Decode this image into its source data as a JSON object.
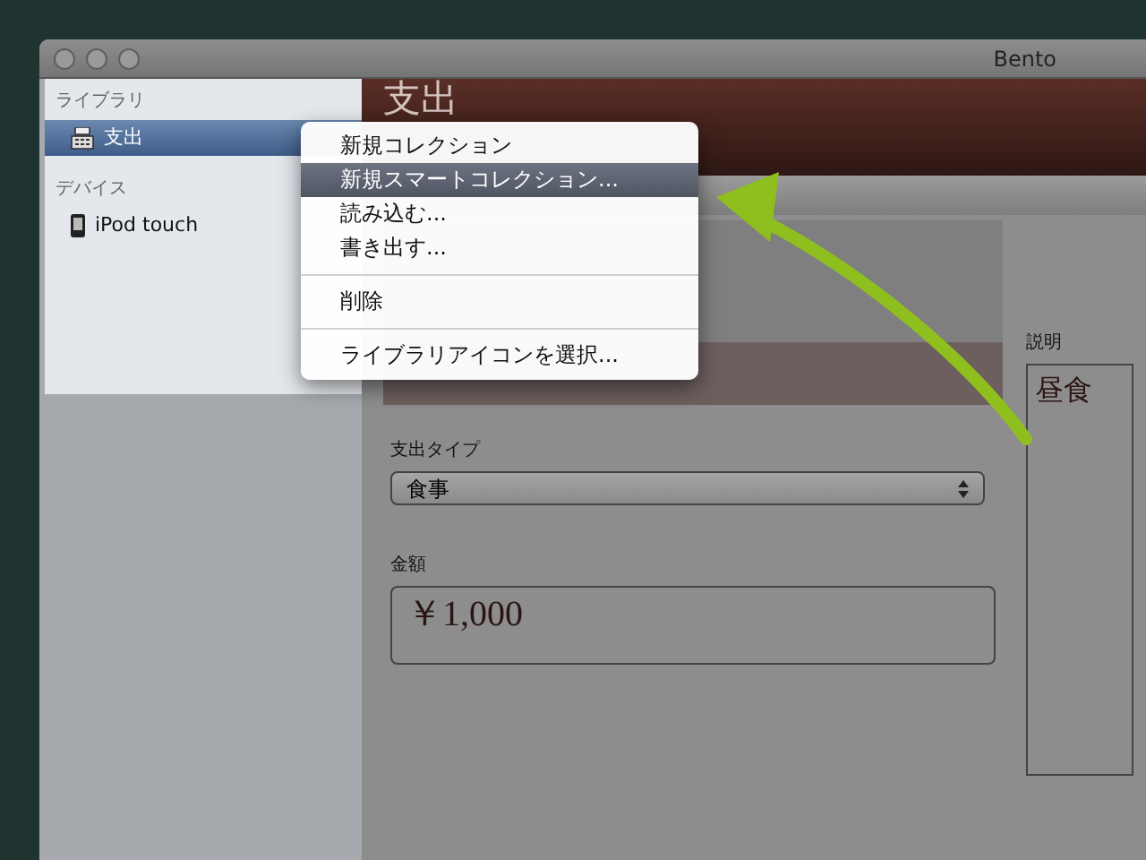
{
  "window": {
    "title": "Bento"
  },
  "sidebar": {
    "sections": [
      {
        "heading": "ライブラリ",
        "items": [
          {
            "label": "支出",
            "kind": "register",
            "selected": true
          }
        ]
      },
      {
        "heading": "デバイス",
        "items": [
          {
            "label": "iPod touch",
            "kind": "device",
            "selected": false
          }
        ]
      }
    ]
  },
  "header": {
    "title": "支出"
  },
  "form": {
    "fields": [
      {
        "label": "支出タイプ",
        "kind": "select",
        "value": "食事"
      },
      {
        "label": "金額",
        "kind": "text",
        "value": "￥1,000"
      }
    ],
    "side_field": {
      "label": "説明",
      "value": "昼食"
    }
  },
  "context_menu": {
    "items": [
      {
        "kind": "item",
        "label": "新規コレクション",
        "selected": false
      },
      {
        "kind": "item",
        "label": "新規スマートコレクション...",
        "selected": true
      },
      {
        "kind": "item",
        "label": "読み込む...",
        "selected": false
      },
      {
        "kind": "item",
        "label": "書き出す...",
        "selected": false
      },
      {
        "kind": "separator"
      },
      {
        "kind": "item",
        "label": "削除",
        "selected": false
      },
      {
        "kind": "separator"
      },
      {
        "kind": "item",
        "label": "ライブラリアイコンを選択...",
        "selected": false
      }
    ]
  }
}
